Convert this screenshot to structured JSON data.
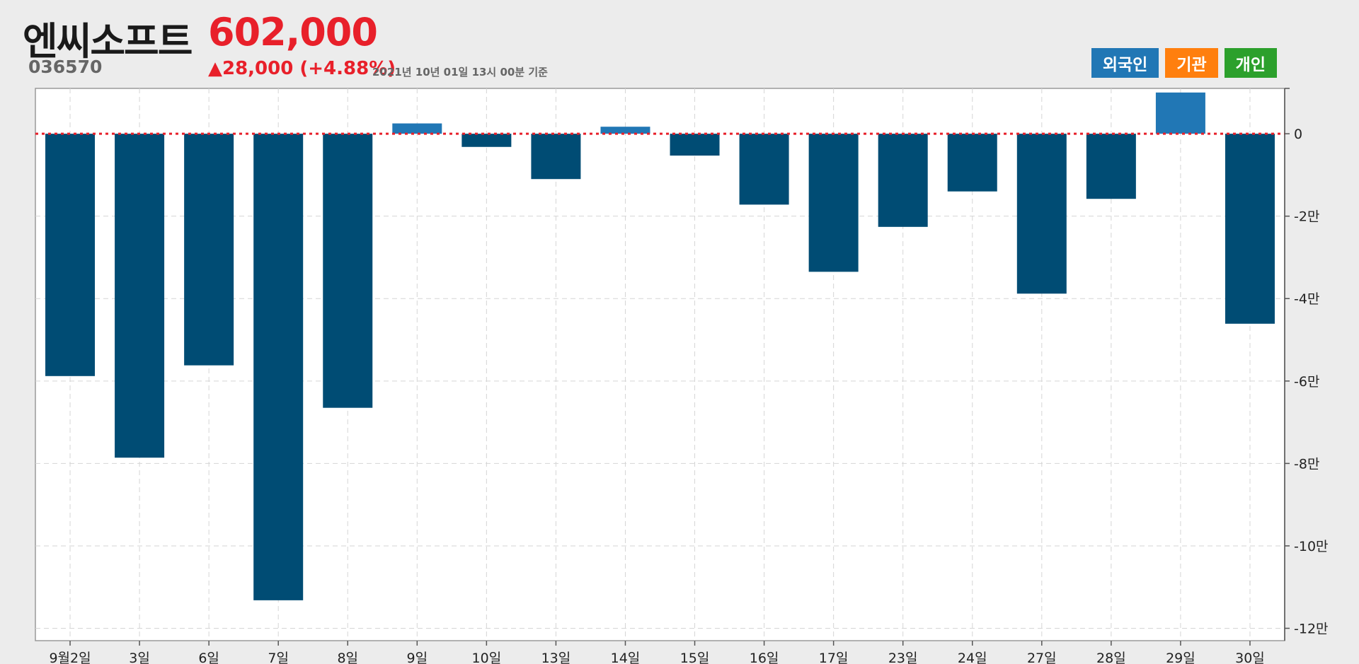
{
  "stock": {
    "name": "엔씨소프트",
    "code": "036570",
    "price": "602,000",
    "change": "▲28,000 (+4.88%)",
    "timestamp": "2021년 10년 01일 13시 00분 기준"
  },
  "filters": [
    {
      "label": "외국인",
      "color": "#2177b5"
    },
    {
      "label": "기관",
      "color": "#ff7f0e"
    },
    {
      "label": "개인",
      "color": "#2ca02c"
    }
  ],
  "colors": {
    "negative_bar": "#004c74",
    "positive_bar": "#2177b5",
    "zero_line": "#e8202a"
  },
  "chart_data": {
    "type": "bar",
    "categories": [
      "9월2일",
      "3일",
      "6일",
      "7일",
      "8일",
      "9일",
      "10일",
      "13일",
      "14일",
      "15일",
      "16일",
      "17일",
      "23일",
      "24일",
      "27일",
      "28일",
      "29일",
      "30일"
    ],
    "series": [
      {
        "values": [
          -58800,
          -78600,
          -56200,
          -113200,
          -66500,
          2500,
          -3200,
          -11000,
          1700,
          -5300,
          -17200,
          -33500,
          -22600,
          -14000,
          -38800,
          -15800,
          10000,
          -46100
        ]
      }
    ],
    "yticks": [
      0,
      -20000,
      -40000,
      -60000,
      -80000,
      -100000,
      -120000
    ],
    "ytick_labels": [
      "0",
      "-2만",
      "-4만",
      "-6만",
      "-8만",
      "-10만",
      "-12만"
    ],
    "ylim": [
      -123000,
      11000
    ],
    "grid": true,
    "zero_line": "dotted"
  }
}
